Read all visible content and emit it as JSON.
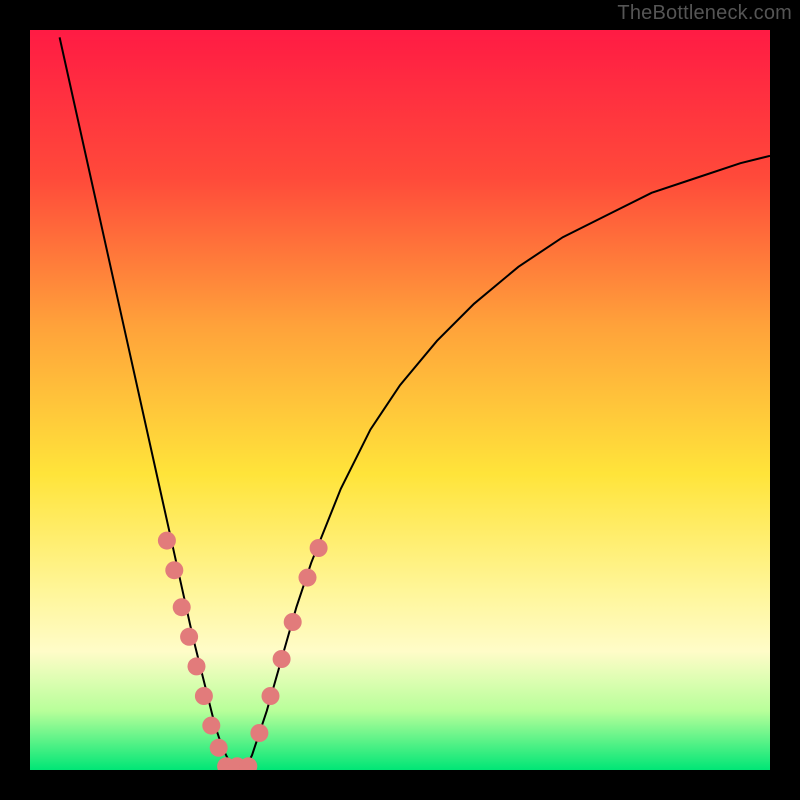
{
  "watermark": "TheBottleneck.com",
  "colors": {
    "dot": "#e27b7b",
    "curve": "#000000",
    "gradient_stops": [
      "#ff1b44",
      "#ff4a3a",
      "#ffa23a",
      "#ffe43a",
      "#fff69a",
      "#fffcc8",
      "#b8ff9a",
      "#00e676"
    ]
  },
  "chart_data": {
    "type": "line",
    "title": "",
    "xlabel": "",
    "ylabel": "",
    "xlim": [
      0,
      100
    ],
    "ylim": [
      0,
      100
    ],
    "grid": false,
    "legend": false,
    "series": [
      {
        "name": "left-curve",
        "x": [
          4,
          6,
          8,
          10,
          12,
          14,
          16,
          18,
          20,
          22,
          24,
          25,
          26,
          27,
          28
        ],
        "y": [
          99,
          90,
          81,
          72,
          63,
          54,
          45,
          36,
          27,
          18,
          10,
          6,
          3,
          1,
          0
        ]
      },
      {
        "name": "right-curve",
        "x": [
          29,
          30,
          32,
          34,
          36,
          38,
          42,
          46,
          50,
          55,
          60,
          66,
          72,
          78,
          84,
          90,
          96,
          100
        ],
        "y": [
          0,
          2,
          8,
          15,
          22,
          28,
          38,
          46,
          52,
          58,
          63,
          68,
          72,
          75,
          78,
          80,
          82,
          83
        ]
      }
    ],
    "points": [
      {
        "name": "left-dots",
        "x": [
          18.5,
          19.5,
          20.5,
          21.5,
          22.5,
          23.5,
          24.5,
          25.5
        ],
        "y": [
          31,
          27,
          22,
          18,
          14,
          10,
          6,
          3
        ]
      },
      {
        "name": "floor-dots",
        "x": [
          26.5,
          28.0,
          29.5
        ],
        "y": [
          0.5,
          0.5,
          0.5
        ]
      },
      {
        "name": "right-dots",
        "x": [
          31.0,
          32.5,
          34.0,
          35.5,
          37.5,
          39.0
        ],
        "y": [
          5,
          10,
          15,
          20,
          26,
          30
        ]
      }
    ]
  }
}
